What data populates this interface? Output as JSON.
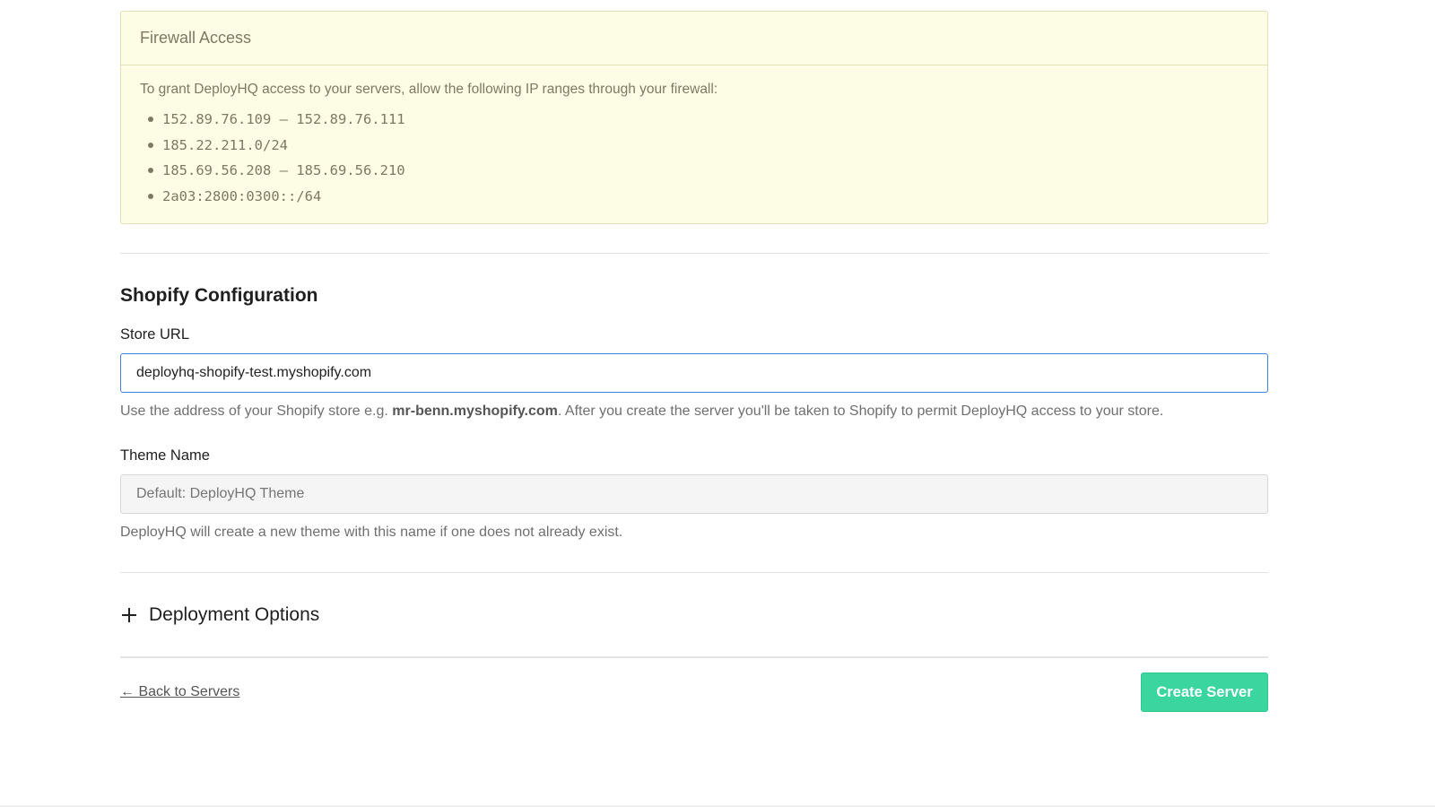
{
  "firewall": {
    "title": "Firewall Access",
    "intro": "To grant DeployHQ access to your servers, allow the following IP ranges through your firewall:",
    "ip_ranges": [
      "152.89.76.109 – 152.89.76.111",
      "185.22.211.0/24",
      "185.69.56.208 – 185.69.56.210",
      "2a03:2800:0300::/64"
    ]
  },
  "shopify": {
    "section_title": "Shopify Configuration",
    "store_url": {
      "label": "Store URL",
      "value": "deployhq-shopify-test.myshopify.com",
      "help_prefix": "Use the address of your Shopify store e.g. ",
      "help_example": "mr-benn.myshopify.com",
      "help_suffix": ". After you create the server you'll be taken to Shopify to permit DeployHQ access to your store."
    },
    "theme_name": {
      "label": "Theme Name",
      "placeholder": "Default: DeployHQ Theme",
      "help": "DeployHQ will create a new theme with this name if one does not already exist."
    }
  },
  "deployment_options": {
    "label": "Deployment Options",
    "icon": "plus-icon"
  },
  "footer": {
    "back_label": "← Back to Servers",
    "create_label": "Create Server",
    "create_color": "#3bd6a0"
  }
}
